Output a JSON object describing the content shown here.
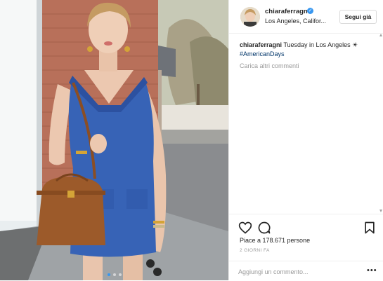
{
  "post": {
    "username": "chiaraferragni",
    "verified": true,
    "location": "Los Angeles, Califor...",
    "follow_label": "Segui già",
    "caption_author": "chiaraferragni",
    "caption_text": " Tuesday in Los Angeles ☀",
    "caption_hashtag": "#AmericanDays",
    "load_more_comments": "Carica altri commenti",
    "likes_text": "Piace a 178.671 persone",
    "time_ago": "2 GIORNI FA",
    "comment_placeholder": "Aggiungi un commento...",
    "more_options": "•••"
  },
  "carousel": {
    "count": 3,
    "active": 0
  },
  "icons": {
    "verified": "verified-badge-icon",
    "like": "heart-icon",
    "comment": "comment-bubble-icon",
    "save": "bookmark-icon",
    "options": "more-options-icon"
  },
  "colors": {
    "accent": "#3897f0",
    "hashtag": "#003569",
    "muted": "#999999",
    "text": "#262626",
    "border": "#efefef"
  }
}
